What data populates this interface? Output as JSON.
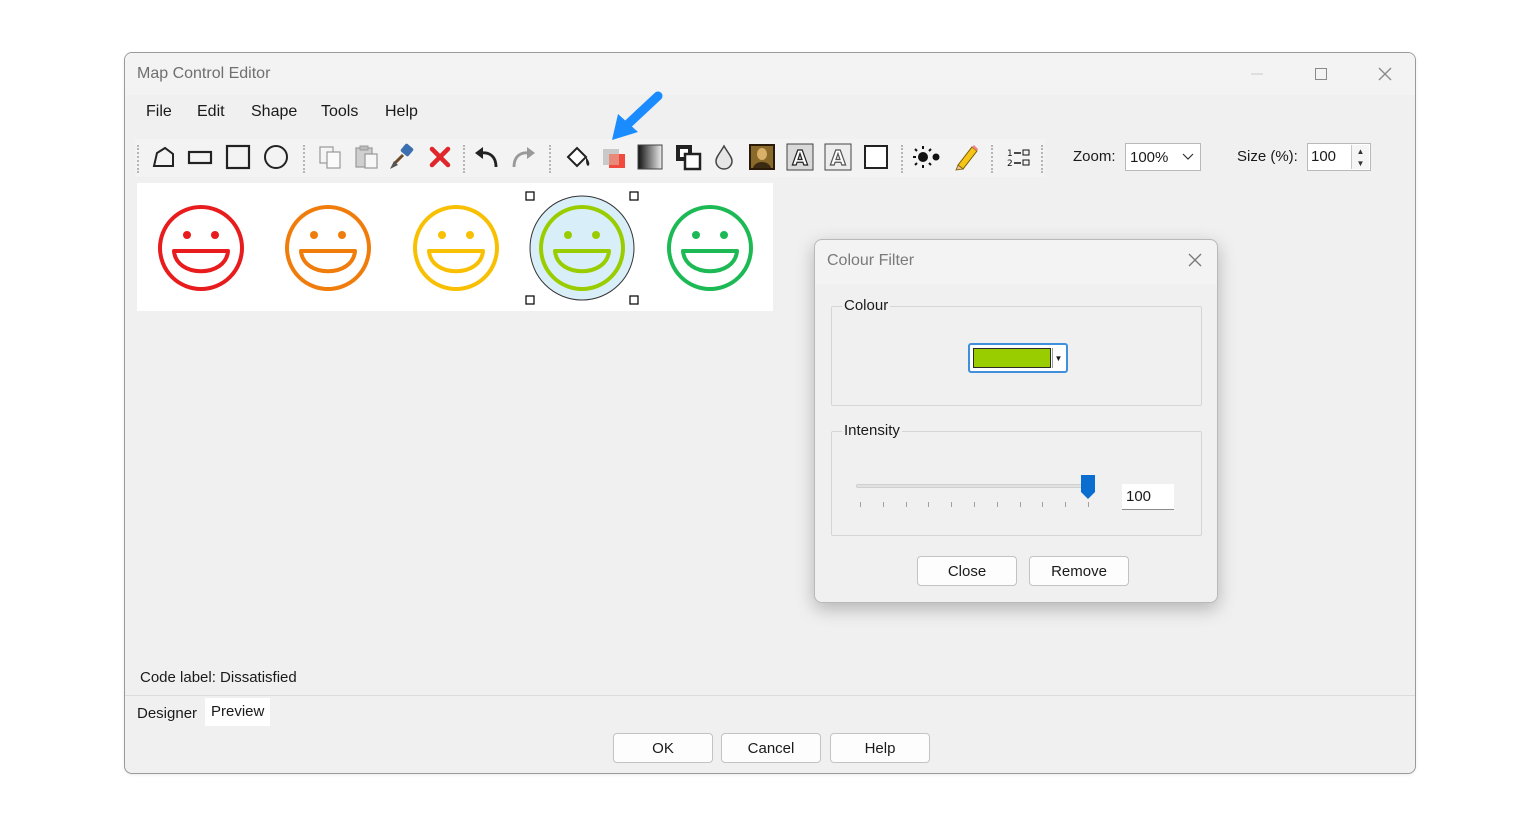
{
  "window": {
    "title": "Map Control Editor"
  },
  "menu": {
    "file": "File",
    "edit": "Edit",
    "shape": "Shape",
    "tools": "Tools",
    "help": "Help"
  },
  "toolbar": {
    "zoom_label": "Zoom:",
    "zoom_value": "100%",
    "size_label": "Size (%):",
    "size_value": "100"
  },
  "canvas": {
    "smileys": [
      {
        "color": "#e81c1c"
      },
      {
        "color": "#f07c0c"
      },
      {
        "color": "#f9c003"
      },
      {
        "color": "#9acd00",
        "selected": true
      },
      {
        "color": "#1db954"
      }
    ]
  },
  "status": {
    "code_label": "Code label: Dissatisfied"
  },
  "tabs": {
    "designer": "Designer",
    "preview": "Preview"
  },
  "buttons": {
    "ok": "OK",
    "cancel": "Cancel",
    "help": "Help"
  },
  "dialog": {
    "title": "Colour Filter",
    "colour_group": "Colour",
    "colour_value": "#9acd00",
    "intensity_group": "Intensity",
    "intensity_value": "100",
    "close": "Close",
    "remove": "Remove"
  },
  "accent_colors": {
    "arrow": "#1a8cff",
    "slider_thumb": "#0a6ed1"
  }
}
